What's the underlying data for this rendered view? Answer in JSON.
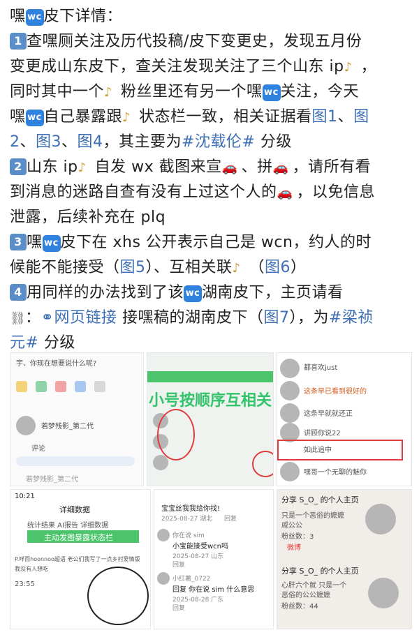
{
  "post": {
    "l1": {
      "a": "嘿",
      "badge": "wc",
      "b": "皮下详情："
    },
    "l2": {
      "num": "1",
      "a": "查嘿厕关注及历代投稿/皮下变更史，发现五月份"
    },
    "l3": {
      "a": "变更成山东皮下，查关注发现关注了三个山东 ip",
      "b": "，"
    },
    "l4": {
      "a": "同时其中一个",
      "b": "粉丝里还有另一个嘿",
      "badge": "wc",
      "c": "关注，今天"
    },
    "l5": {
      "a": "嘿",
      "badge": "wc",
      "b": "自己暴露跟",
      "c": "状态栏一致，相关证据看",
      "link1": "图1",
      "d": "、",
      "link2": "图"
    },
    "l6": {
      "link1": "2",
      "a": "、",
      "link2": "图3",
      "b": "、",
      "link3": "图4",
      "c": "，其主要为",
      "tag": "#沈载伦#",
      "d": " 分级"
    },
    "l7": {
      "num": "2",
      "a": "山东 ip",
      "b": "自发 wx 截图来宣",
      "c": "、拼",
      "d": "，请所有看"
    },
    "l8": {
      "a": "到消息的迷路自查有没有上过这个人的",
      "b": "，以免信息"
    },
    "l9": {
      "a": "泄露，后续补充在 plq"
    },
    "l10": {
      "num": "3",
      "a": "嘿",
      "badge": "wc",
      "b": "皮下在 xhs 公开表示自己是 wcn，约人的时"
    },
    "l11": {
      "a": "候能不能接受（",
      "link1": "图5",
      "b": "）、互相关联",
      "c": "（",
      "link2": "图6",
      "d": "）"
    },
    "l12": {
      "num": "4",
      "a": "用同样的办法找到了该",
      "badge": "wc",
      "b": "湖南皮下，主页请看"
    },
    "l13": {
      "a": "：",
      "link": "网页链接",
      "b": " 接嘿稿的湖南皮下（",
      "link2": "图7",
      "c": "），为",
      "tag": "#梁祯"
    },
    "l14": {
      "tag": "元#",
      "a": " 分级"
    }
  },
  "gallery": {
    "s1": {
      "header": "宇、你现在想要说什么呢?",
      "name": "若梦残影_第二代",
      "comment": "评论",
      "name2": "若梦残影_第二代"
    },
    "s2": {
      "overlay": "小号按顺序互相关"
    },
    "s3": {
      "row1": "都喜欢just",
      "row2": "这条早已看到很好的",
      "row3": "这条早就就还正",
      "row4": "讲顾你说22",
      "row5": "如此追中",
      "row6": "嘿哥一个无聊的魅你"
    },
    "s4": {
      "time": "10:21",
      "tabs": "统计结果  AI报告  详细数据",
      "title": "详细数据",
      "banner": "主动发图暴露状态栏",
      "text1": "P.咩而hoonnoo超语 老公们我写了一点乡村爱情版",
      "text2": "我没有人想吃",
      "time2": "23:55"
    },
    "s5": {
      "c1": "宝宝丝我我给你找!",
      "d1": "2025-08-27 湖北",
      "r1": "回复",
      "u2": "你在说 sim",
      "c2": "小宝能接受wcn吗",
      "d2": "2025-08-27 山东",
      "r2": "回复",
      "u3": "小红薯_0722",
      "c3": "回复 你在说 sim 什么意思",
      "d3": "2025-08-28 广东",
      "r3": "回复"
    },
    "s6": {
      "t1": "分享 S_O_ 的个人主页",
      "t2": "只是一个恶俗的嬷嬷",
      "t3": "戚公公",
      "t4": "粉丝数：3",
      "t5": "微博",
      "t6": "分享 S_O_ 的个人主页",
      "t7": "心肝六个就 只是一个",
      "t8": "恶俗的公公嬷嬷",
      "t9": "粉丝数：44"
    }
  }
}
